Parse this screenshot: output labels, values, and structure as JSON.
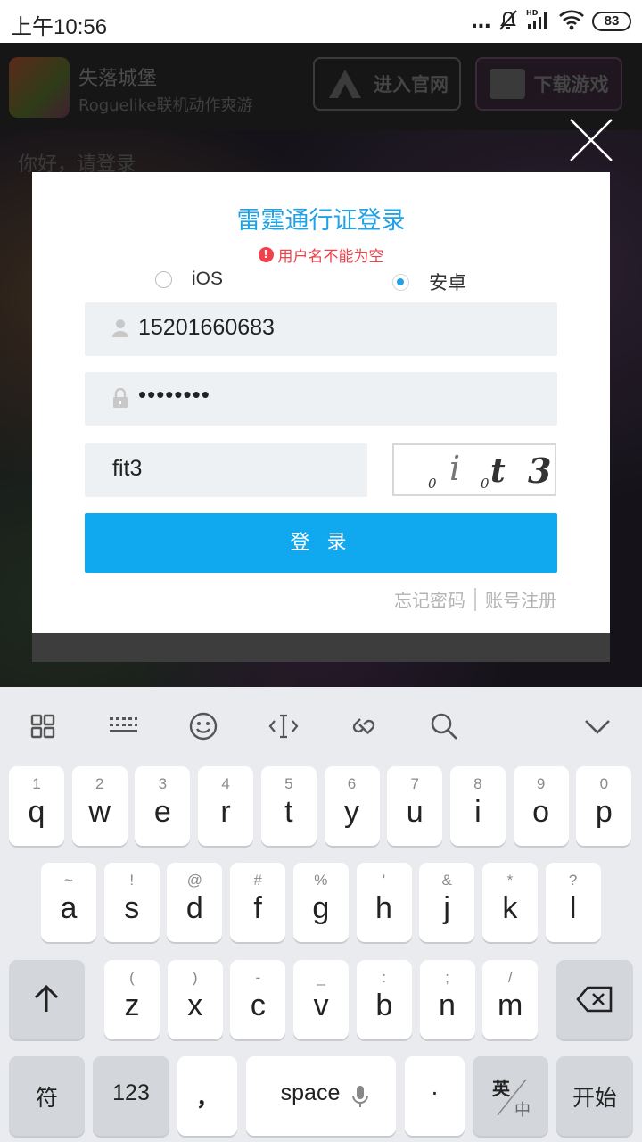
{
  "status_bar": {
    "time": "上午10:56",
    "dots": "...",
    "battery": "83",
    "icons": [
      "mute-bell-icon",
      "hd-signal-icon",
      "wifi-icon",
      "battery-icon"
    ]
  },
  "background_page": {
    "game_name": "失落城堡",
    "game_subtitle": "Roguelike联机动作爽游",
    "site_button": "进入官网",
    "download_button": "下载游戏",
    "greeting": "你好，请登录"
  },
  "dialog": {
    "title": "雷霆通行证登录",
    "error": "用户名不能为空",
    "radio_ios": "iOS",
    "radio_android": "安卓",
    "selected_platform": "安卓",
    "username": "15201660683",
    "password_masked": "••••••••",
    "captcha_input": "fit3",
    "captcha_chars": [
      "0",
      "i",
      "0",
      "t",
      "3"
    ],
    "login_button": "登 录",
    "forgot_password": "忘记密码",
    "register": "账号注册",
    "accent_color": "#1fa3e6",
    "error_color": "#f0424c"
  },
  "keyboard": {
    "toolbar_icons": [
      "grid-icon",
      "keyboard-icon",
      "emoji-icon",
      "cursor-icon",
      "clip-icon",
      "search-icon",
      "collapse-icon"
    ],
    "row1": [
      {
        "ch": "q",
        "hint": "1"
      },
      {
        "ch": "w",
        "hint": "2"
      },
      {
        "ch": "e",
        "hint": "3"
      },
      {
        "ch": "r",
        "hint": "4"
      },
      {
        "ch": "t",
        "hint": "5"
      },
      {
        "ch": "y",
        "hint": "6"
      },
      {
        "ch": "u",
        "hint": "7"
      },
      {
        "ch": "i",
        "hint": "8"
      },
      {
        "ch": "o",
        "hint": "9"
      },
      {
        "ch": "p",
        "hint": "0"
      }
    ],
    "row2": [
      {
        "ch": "a",
        "hint": "~"
      },
      {
        "ch": "s",
        "hint": "!"
      },
      {
        "ch": "d",
        "hint": "@"
      },
      {
        "ch": "f",
        "hint": "#"
      },
      {
        "ch": "g",
        "hint": "%"
      },
      {
        "ch": "h",
        "hint": "'"
      },
      {
        "ch": "j",
        "hint": "&"
      },
      {
        "ch": "k",
        "hint": "*"
      },
      {
        "ch": "l",
        "hint": "?"
      }
    ],
    "row3": [
      {
        "ch": "z",
        "hint": "("
      },
      {
        "ch": "x",
        "hint": ")"
      },
      {
        "ch": "c",
        "hint": "-"
      },
      {
        "ch": "v",
        "hint": "_"
      },
      {
        "ch": "b",
        "hint": ":"
      },
      {
        "ch": "n",
        "hint": ";"
      },
      {
        "ch": "m",
        "hint": "/"
      }
    ],
    "symbols": "符",
    "numbers": "123",
    "comma": "，",
    "space": "space",
    "period": "·",
    "lang_top": "英",
    "lang_bottom": "中",
    "enter": "开始"
  }
}
